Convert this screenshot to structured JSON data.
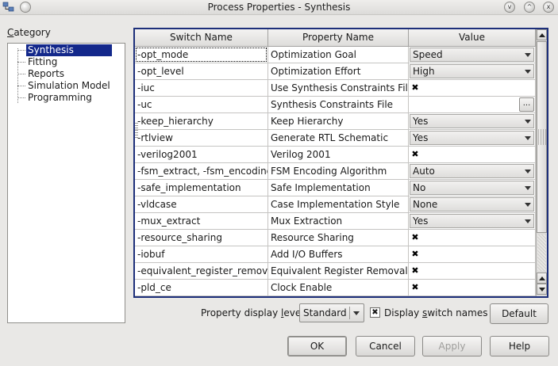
{
  "window": {
    "title": "Process Properties - Synthesis",
    "controls": {
      "minimize": "v",
      "maximize": "^",
      "close": "x"
    }
  },
  "category": {
    "label_prefix": "C",
    "label_rest": "ategory",
    "items": [
      {
        "label": "Synthesis",
        "selected": true
      },
      {
        "label": "Fitting"
      },
      {
        "label": "Reports"
      },
      {
        "label": "Simulation Model"
      },
      {
        "label": "Programming"
      }
    ]
  },
  "table": {
    "headers": [
      "Switch Name",
      "Property Name",
      "Value"
    ],
    "rows": [
      {
        "switch": "-opt_mode",
        "property": "Optimization Goal",
        "type": "combo",
        "value": "Speed"
      },
      {
        "switch": "-opt_level",
        "property": "Optimization Effort",
        "type": "combo",
        "value": "High"
      },
      {
        "switch": "-iuc",
        "property": "Use Synthesis Constraints File",
        "type": "check",
        "value": "✖"
      },
      {
        "switch": "-uc",
        "property": "Synthesis Constraints File",
        "type": "file",
        "value": "..."
      },
      {
        "switch": "-keep_hierarchy",
        "property": "Keep Hierarchy",
        "type": "combo",
        "value": "Yes"
      },
      {
        "switch": "-rtlview",
        "property": "Generate RTL Schematic",
        "type": "combo",
        "value": "Yes"
      },
      {
        "switch": "-verilog2001",
        "property": "Verilog 2001",
        "type": "check",
        "value": "✖"
      },
      {
        "switch": "-fsm_extract, -fsm_encoding",
        "property": "FSM Encoding Algorithm",
        "type": "combo",
        "value": "Auto"
      },
      {
        "switch": "-safe_implementation",
        "property": "Safe Implementation",
        "type": "combo",
        "value": "No"
      },
      {
        "switch": "-vldcase",
        "property": "Case Implementation Style",
        "type": "combo",
        "value": "None"
      },
      {
        "switch": "-mux_extract",
        "property": "Mux Extraction",
        "type": "combo",
        "value": "Yes"
      },
      {
        "switch": "-resource_sharing",
        "property": "Resource Sharing",
        "type": "check",
        "value": "✖"
      },
      {
        "switch": "-iobuf",
        "property": "Add I/O Buffers",
        "type": "check",
        "value": "✖"
      },
      {
        "switch": "-equivalent_register_removal",
        "property": "Equivalent Register Removal",
        "type": "check",
        "value": "✖"
      },
      {
        "switch": "-pld_ce",
        "property": "Clock Enable",
        "type": "check",
        "value": "✖"
      }
    ]
  },
  "footer": {
    "display_level_label": "Property display level:",
    "display_level_value": "Standard",
    "display_switch_check": "✖",
    "display_switch_label": "Display switch names",
    "default_button": "Default"
  },
  "buttons": {
    "ok": "OK",
    "cancel": "Cancel",
    "apply": "Apply",
    "help": "Help"
  }
}
